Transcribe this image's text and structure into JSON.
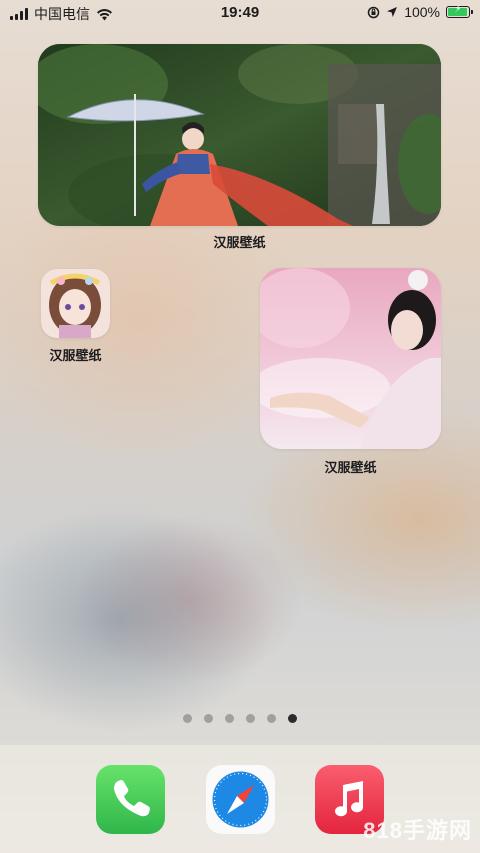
{
  "status_bar": {
    "carrier": "中国电信",
    "time": "19:49",
    "battery": "100%",
    "battery_level": 1.0
  },
  "widgets": [
    {
      "label": "汉服壁纸",
      "image": "hanfu-umbrella-photo"
    },
    {
      "label": "汉服壁纸",
      "image": "anime-girl-icon"
    },
    {
      "label": "汉服壁纸",
      "image": "hanfu-pink-photo"
    }
  ],
  "pages": {
    "count": 6,
    "current": 6
  },
  "dock": [
    {
      "name": "phone-icon"
    },
    {
      "name": "safari-icon"
    },
    {
      "name": "music-icon"
    }
  ],
  "watermark": "818手游网",
  "colors": {
    "battery_green": "#34c759",
    "phone_green": "#34c759",
    "music_red": "#f0344a",
    "safari_blue": "#1e88e5"
  }
}
